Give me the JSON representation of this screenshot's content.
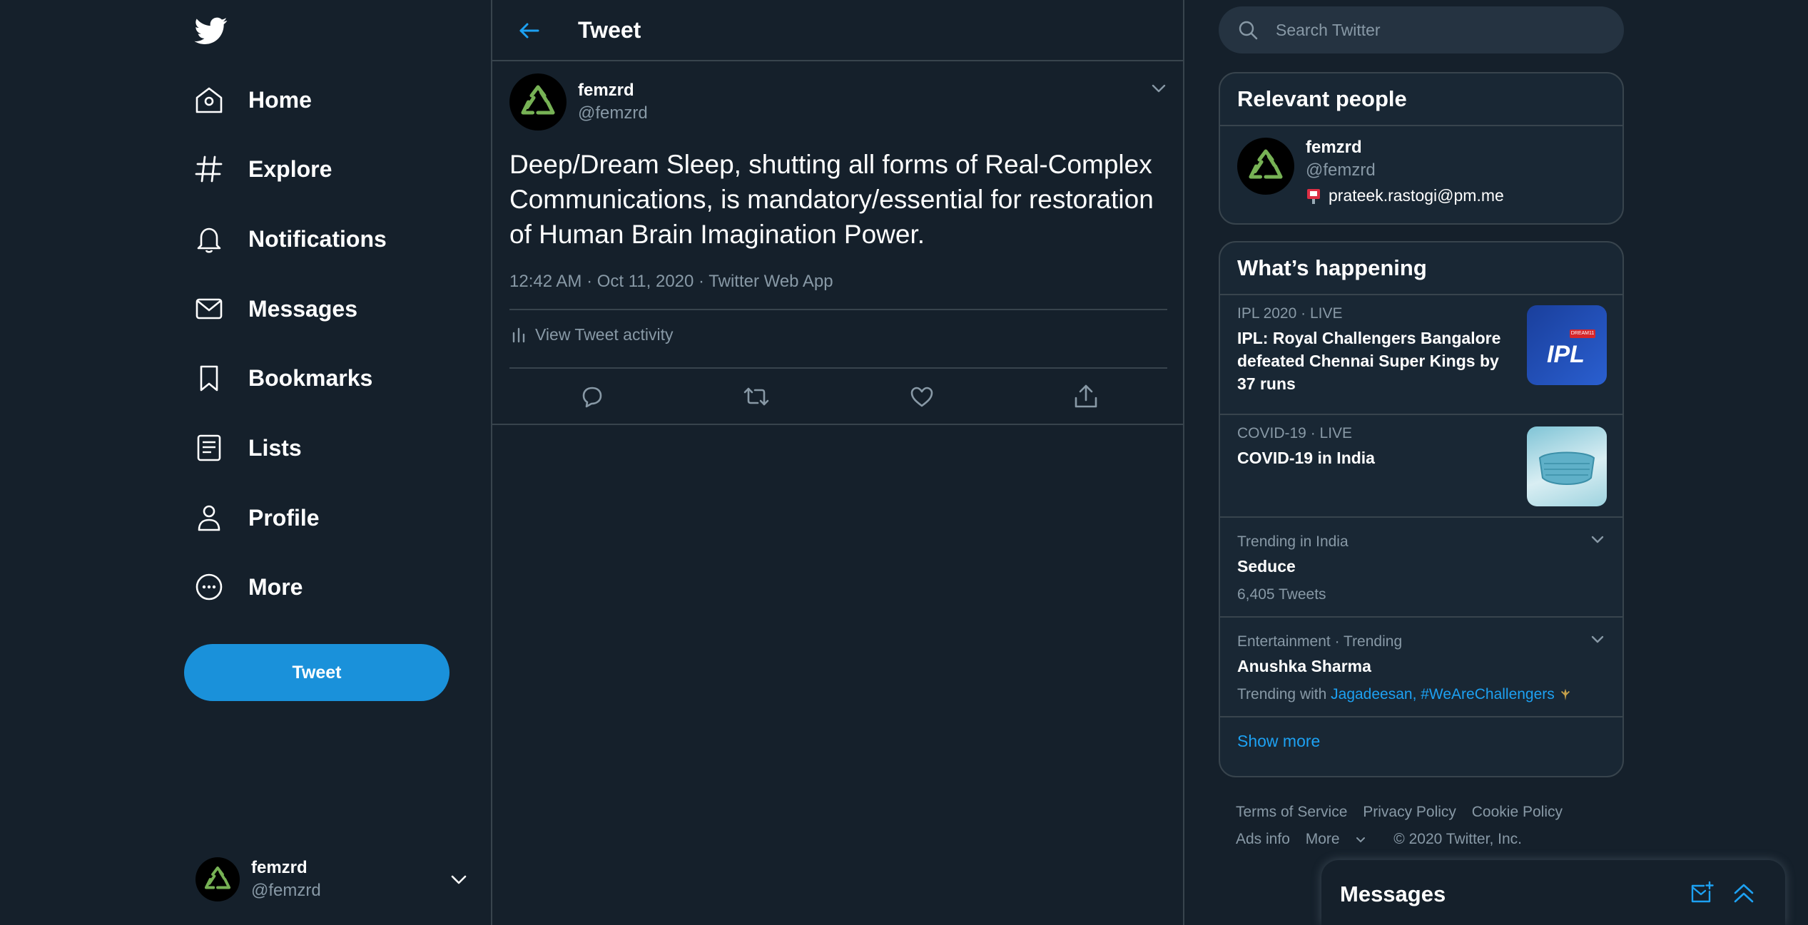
{
  "colors": {
    "background": "#15202b",
    "accent": "#1da1f2",
    "button": "#1a91da",
    "secondary_text": "#8899a6",
    "border": "#38444d",
    "recycle_green": "#77b255"
  },
  "nav": {
    "items": [
      {
        "label": "Home",
        "icon": "home-icon"
      },
      {
        "label": "Explore",
        "icon": "hashtag-icon"
      },
      {
        "label": "Notifications",
        "icon": "bell-icon"
      },
      {
        "label": "Messages",
        "icon": "envelope-icon"
      },
      {
        "label": "Bookmarks",
        "icon": "bookmark-icon"
      },
      {
        "label": "Lists",
        "icon": "list-icon"
      },
      {
        "label": "Profile",
        "icon": "person-icon"
      },
      {
        "label": "More",
        "icon": "more-dots-icon"
      }
    ],
    "tweet_button": "Tweet"
  },
  "account": {
    "name": "femzrd",
    "handle": "@femzrd"
  },
  "main": {
    "title": "Tweet",
    "tweet": {
      "author_name": "femzrd",
      "author_handle": "@femzrd",
      "text": "Deep/Dream Sleep, shutting all forms of Real-Complex Communications, is mandatory/essential for restoration of Human Brain Imagination Power.",
      "meta": "12:42 AM · Oct 11, 2020 · Twitter Web App",
      "activity_label": "View Tweet activity"
    }
  },
  "search": {
    "placeholder": "Search Twitter"
  },
  "relevant_people": {
    "title": "Relevant people",
    "person": {
      "name": "femzrd",
      "handle": "@femzrd",
      "bio": "prateek.rastogi@pm.me"
    }
  },
  "trends": {
    "title": "What’s happening",
    "items": [
      {
        "meta": "IPL 2020 · LIVE",
        "title": "IPL: Royal Challengers Bangalore defeated Chennai Super Kings by 37 runs",
        "thumb_text": "IPL",
        "thumb_badge": "DREAM11"
      },
      {
        "meta": "COVID-19 · LIVE",
        "title": "COVID-19 in India"
      },
      {
        "meta": "Trending in India",
        "title": "Seduce",
        "sub": "6,405 Tweets"
      },
      {
        "meta": "Entertainment · Trending",
        "title": "Anushka Sharma",
        "sub_prefix": "Trending with",
        "links": "Jagadeesan, #WeAreChallengers"
      }
    ],
    "show_more": "Show more"
  },
  "footer": {
    "links": [
      "Terms of Service",
      "Privacy Policy",
      "Cookie Policy",
      "Ads info",
      "More"
    ],
    "copyright": "© 2020 Twitter, Inc."
  },
  "messages_drawer": {
    "title": "Messages"
  }
}
